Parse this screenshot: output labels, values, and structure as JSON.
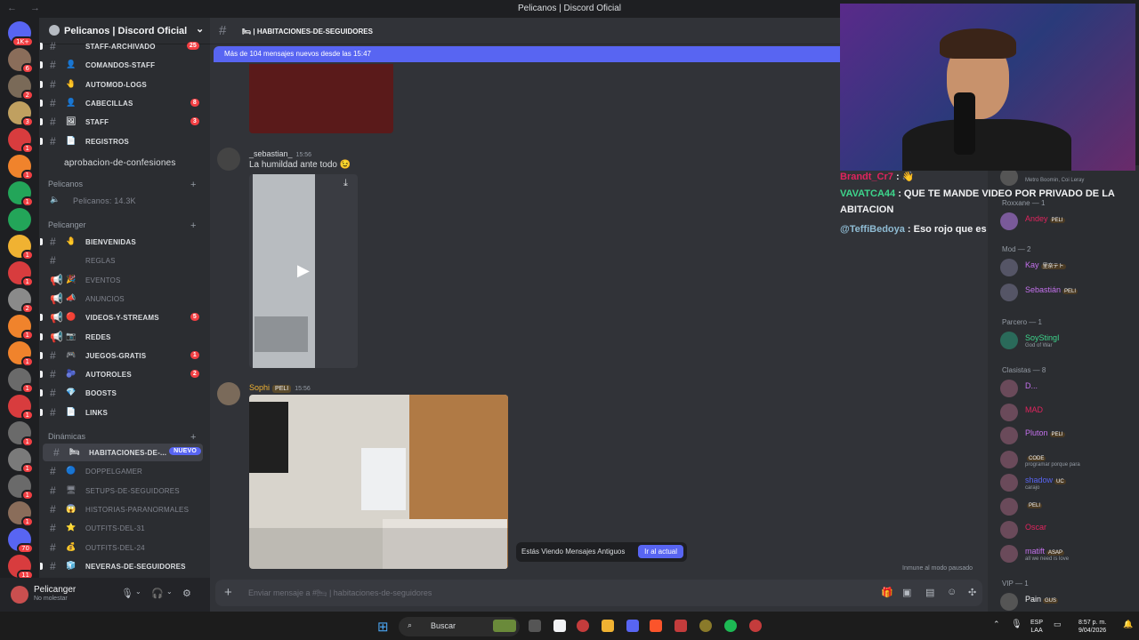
{
  "window": {
    "title": "Pelicanos | Discord Oficial",
    "nav": "← →"
  },
  "servers": [
    {
      "color": "#5865f2",
      "badge": "1K+"
    },
    {
      "color": "#8a6d5a",
      "badge": "6"
    },
    {
      "color": "#7a6a58",
      "badge": "2"
    },
    {
      "color": "#c0a060",
      "badge": "3"
    },
    {
      "color": "#d83c3e",
      "badge": "1"
    },
    {
      "color": "#f0832c",
      "badge": "1"
    },
    {
      "color": "#23a559",
      "badge": "1"
    },
    {
      "color": "#23a559",
      "badge": ""
    },
    {
      "color": "#f0b232",
      "badge": "1"
    },
    {
      "color": "#d83c3e",
      "badge": "1"
    },
    {
      "color": "#8a8a8a",
      "badge": "2"
    },
    {
      "color": "#f0832c",
      "badge": "1"
    },
    {
      "color": "#f0832c",
      "badge": "1"
    },
    {
      "color": "#6a6a6a",
      "badge": "1"
    },
    {
      "color": "#d83c3e",
      "badge": "1"
    },
    {
      "color": "#6a6a6a",
      "badge": "1"
    },
    {
      "color": "#7a7a7a",
      "badge": "1"
    },
    {
      "color": "#6a6a6a",
      "badge": "1"
    },
    {
      "color": "#8a6d5a",
      "badge": "1"
    },
    {
      "color": "#5865f2",
      "badge": "70"
    },
    {
      "color": "#d83c3e",
      "badge": "11"
    },
    {
      "color": "#5865f2",
      "badge": ""
    }
  ],
  "server_header": {
    "name": "Pelicanos | Discord Oficial",
    "chevron": "⌄",
    "invite_icon": "👤"
  },
  "channels": {
    "top": [
      {
        "emoji": "",
        "label": "staff-archivado",
        "count": "25",
        "muted": false
      },
      {
        "emoji": "👤",
        "label": "comandos-staff",
        "count": "",
        "muted": false
      },
      {
        "emoji": "🤚",
        "label": "automod-logs",
        "count": "",
        "muted": false
      },
      {
        "emoji": "👤",
        "label": "cabecillas",
        "count": "8",
        "muted": false
      },
      {
        "emoji": "🖼",
        "label": "staff",
        "count": "3",
        "muted": false
      },
      {
        "emoji": "📄",
        "label": "registros",
        "count": "",
        "muted": false
      },
      {
        "emoji": "",
        "label": "aprobacion-de-confesiones",
        "count": "",
        "muted": false
      }
    ],
    "cat_pelicanos": "Pelicanos",
    "voice": "Pelicanos: 14.3K",
    "cat_pelicanger": "Pelicanger",
    "pelicanger": [
      {
        "emoji": "🤚",
        "label": "bienvenidas",
        "count": "",
        "muted": false,
        "hash": "#"
      },
      {
        "emoji": "",
        "label": "reglas",
        "count": "",
        "muted": true,
        "hash": "#"
      },
      {
        "emoji": "🎉",
        "label": "eventos",
        "count": "",
        "muted": true,
        "hash": "📢"
      },
      {
        "emoji": "📣",
        "label": "anuncios",
        "count": "",
        "muted": true,
        "hash": "📢"
      },
      {
        "emoji": "🔴",
        "label": "videos-y-streams",
        "count": "5",
        "muted": false,
        "hash": "📢"
      },
      {
        "emoji": "📷",
        "label": "redes",
        "count": "",
        "muted": false,
        "hash": "📢"
      },
      {
        "emoji": "🎮",
        "label": "juegos-gratis",
        "count": "1",
        "muted": false,
        "hash": "#"
      },
      {
        "emoji": "🫐",
        "label": "autoroles",
        "count": "2",
        "muted": false,
        "hash": "#"
      },
      {
        "emoji": "💎",
        "label": "boosts",
        "count": "",
        "muted": false,
        "hash": "#"
      },
      {
        "emoji": "📄",
        "label": "links",
        "count": "",
        "muted": false,
        "hash": "#"
      }
    ],
    "cat_dinamicas": "Dinámicas",
    "dinamicas": [
      {
        "emoji": "🛏",
        "label": "habitaciones-de-...",
        "count": "",
        "muted": false,
        "hash": "#",
        "selected": true,
        "new": "NUEVO"
      },
      {
        "emoji": "🔵",
        "label": "doppelgamer",
        "count": "",
        "muted": true,
        "hash": "#"
      },
      {
        "emoji": "🖥",
        "label": "setups-de-seguidores",
        "count": "",
        "muted": true,
        "hash": "#"
      },
      {
        "emoji": "😱",
        "label": "historias-paranormales",
        "count": "",
        "muted": true,
        "hash": "#"
      },
      {
        "emoji": "⭐",
        "label": "outfits-del-31",
        "count": "",
        "muted": true,
        "hash": "#"
      },
      {
        "emoji": "💰",
        "label": "outfits-del-24",
        "count": "",
        "muted": true,
        "hash": "#"
      },
      {
        "emoji": "🧊",
        "label": "neveras-de-seguidores",
        "count": "",
        "muted": false,
        "hash": "#"
      }
    ]
  },
  "user": {
    "name": "Pelicanger",
    "status": "No molestar"
  },
  "chat": {
    "channel_name": "habitaciones-de-seguidores",
    "channel_emoji": "🛏",
    "new_messages": "Más de 104 mensajes nuevos desde las 15:47",
    "msg1": {
      "author": "_sebastian_",
      "time": "15:56",
      "text": "La humildad ante todo 😉",
      "download": "⤓",
      "play": "▶"
    },
    "msg2": {
      "author": "Sophi",
      "tag": "PELI",
      "time": "15:56"
    },
    "old_banner": "Estás Viendo Mensajes Antiguos",
    "jump": "Ir al actual",
    "immune": "Inmune al modo pausado",
    "placeholder": "Enviar mensaje a #🛏 | habitaciones-de-seguidores"
  },
  "stream_chat": [
    {
      "user": "Brandt_Cr7",
      "sep": " : ",
      "text": "👋",
      "color": "#e0245e"
    },
    {
      "user": "VAVATCA44",
      "sep": " : ",
      "text": "QUE TE MANDE VIDEO POR PRIVADO DE LA",
      "color": "#3dd68c"
    },
    {
      "user": "",
      "sep": "",
      "text": "ABITACION",
      "color": "#f2f3f5"
    },
    {
      "user": "@TeffiBedoya",
      "sep": " : ",
      "text": "Eso rojo que es",
      "color": "#8fbcd4"
    }
  ],
  "members": {
    "top": {
      "name": "",
      "sub": "Metro Boomin, Coi Leray"
    },
    "roxxane": "Roxxane — 1",
    "andey": {
      "name": "Andey",
      "tag": "PELI"
    },
    "mod": "Mod — 2",
    "mods": [
      {
        "name": "Kay",
        "tag": "里奈テト"
      },
      {
        "name": "Sebastián",
        "tag": "PELI"
      }
    ],
    "parcero": "Parcero — 1",
    "parceros": [
      {
        "name": "SoyStingI",
        "sub": "God of War"
      }
    ],
    "clasistas": "Clasistas — 8",
    "clasistas_list": [
      {
        "name": "D...",
        "tag": "",
        "sub": ""
      },
      {
        "name": "MAD",
        "tag": "",
        "sub": ""
      },
      {
        "name": "Pluton",
        "tag": "PELI",
        "sub": ""
      },
      {
        "name": "",
        "tag": "CODE",
        "sub": "programar porque para"
      },
      {
        "name": "shadow",
        "tag": "UC",
        "sub": "carajo"
      },
      {
        "name": "",
        "tag": "PELI",
        "sub": ""
      },
      {
        "name": "Oscar",
        "tag": "",
        "sub": ""
      },
      {
        "name": "matift",
        "tag": "ASAP",
        "sub": "all we need is love"
      }
    ],
    "vip": "VIP — 1",
    "vip_list": [
      {
        "name": "Pain",
        "tag": "GUS"
      }
    ]
  },
  "taskbar": {
    "search": "Buscar",
    "lang1": "ESP",
    "lang2": "LAA",
    "time": "8:57 p. m.",
    "date": "9/04/2026"
  }
}
